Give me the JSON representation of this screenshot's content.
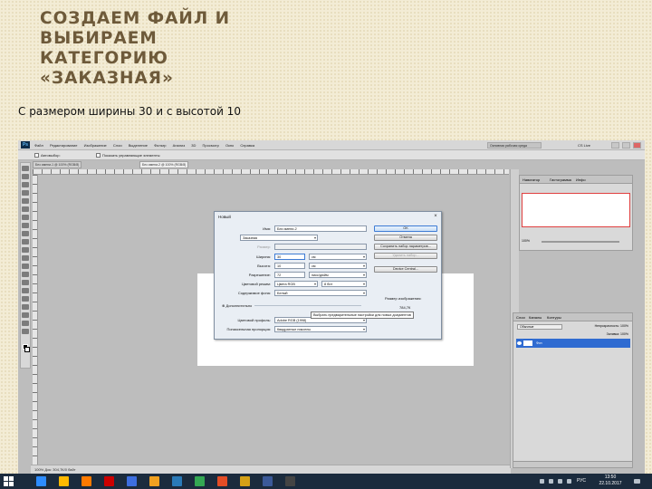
{
  "slide": {
    "title_lines": [
      "СОЗДАЕМ ФАЙЛ И",
      "ВЫБИРАЕМ",
      "КАТЕГОРИЮ",
      "«ЗАКАЗНАЯ»"
    ],
    "subtitle": "С размером ширины 30 и с высотой 10"
  },
  "photoshop": {
    "logo": "Ps",
    "menu": [
      "Файл",
      "Редактирование",
      "Изображение",
      "Слои",
      "Выделение",
      "Фильтр",
      "Анализ",
      "3D",
      "Просмотр",
      "Окно",
      "Справка"
    ],
    "workspace_label": "Основная рабочая среда",
    "cs_live": "CS Live",
    "options_label": "Автовыбор:",
    "options_show": "Показать управляющие элементы",
    "tabs": [
      "Без имени-2 @ 100% (RGB/8)",
      "Без имени-1 @ 100% (RGB/8)"
    ],
    "status_text": "100%   Док: 304,7К/0 байт",
    "navigator": {
      "tabs": [
        "Навигатор",
        "Гистограмма",
        "Инфо"
      ],
      "zoom": "100%"
    },
    "layers": {
      "tabs": [
        "Слои",
        "Каналы",
        "Контуры"
      ],
      "blend_mode": "Обычные",
      "opacity": "Непрозрачность: 100%",
      "fill": "Заливка: 100%",
      "layer_name": "Фон"
    }
  },
  "dialog": {
    "title": "Новый",
    "close_glyph": "×",
    "fields": {
      "name_label": "Имя:",
      "name_value": "Без имени-2",
      "preset_label": "Набор:",
      "preset_value": "Заказная",
      "size_label": "Размер:",
      "size_value": "",
      "width_label": "Ширина:",
      "width_value": "30",
      "width_unit": "см",
      "height_label": "Высота:",
      "height_value": "10",
      "height_unit": "см",
      "resolution_label": "Разрешение:",
      "resolution_value": "72",
      "resolution_unit": "пикс/дюйм",
      "color_mode_label": "Цветовой режим:",
      "color_mode_value": "Цвета RGB",
      "color_depth": "8 бит",
      "bg_label": "Содержимое фона:",
      "bg_value": "Белый",
      "advanced_label": "Дополнительно",
      "profile_label": "Цветовой профиль:",
      "profile_value": "Adobe RGB (1998)",
      "pixel_label": "Попиксельная пропорция:",
      "pixel_value": "Квадратные пикселы"
    },
    "buttons": {
      "ok": "OK",
      "cancel": "Отмена",
      "save_preset": "Сохранить набор параметров...",
      "delete_preset": "Удалить набор...",
      "device_central": "Device Central..."
    },
    "image_size_label": "Размер изображения:",
    "image_size_value": "784,7К",
    "tooltip": "Выбрать предварительные настройки для новых документов"
  },
  "taskbar": {
    "lang": "РУС",
    "time": "13:50",
    "date": "22.10.2017",
    "icon_colors": [
      "#2d8cff",
      "#ffb900",
      "#ff7a00",
      "#cc0000",
      "#3d6ee0",
      "#f0a020",
      "#2a7ab8",
      "#34a853",
      "#e34d26",
      "#d4a017",
      "#3b5998",
      "#444444"
    ]
  }
}
